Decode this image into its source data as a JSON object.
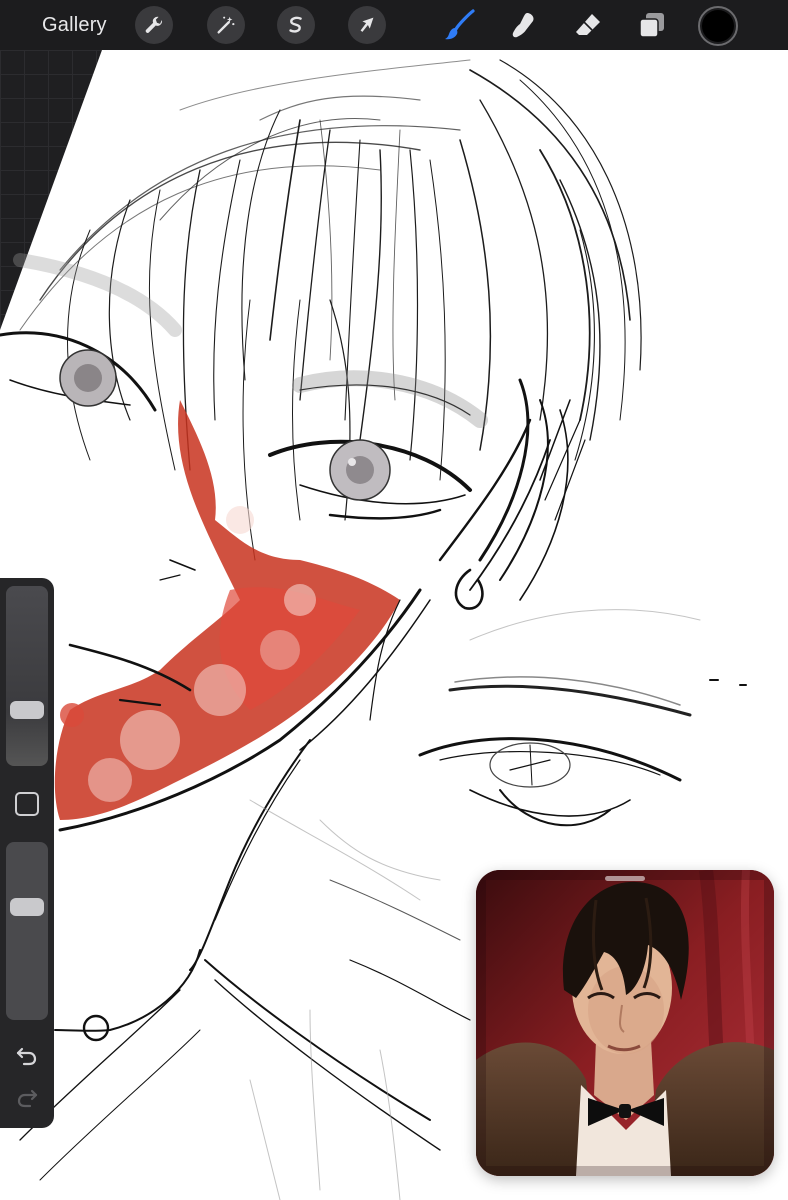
{
  "toolbar": {
    "gallery_label": "Gallery",
    "tools": [
      {
        "id": "actions",
        "icon": "wrench-icon",
        "active": false
      },
      {
        "id": "adjustments",
        "icon": "magic-wand-icon",
        "active": false
      },
      {
        "id": "selection",
        "icon": "selection-s-icon",
        "active": false
      },
      {
        "id": "transform",
        "icon": "arrow-cursor-icon",
        "active": false
      },
      {
        "id": "brush",
        "icon": "brush-icon",
        "active": true
      },
      {
        "id": "smudge",
        "icon": "smudge-finger-icon",
        "active": false
      },
      {
        "id": "eraser",
        "icon": "eraser-icon",
        "active": false
      },
      {
        "id": "layers",
        "icon": "layers-icon",
        "active": false
      }
    ],
    "current_color": "#000000",
    "active_tool_color": "#2f7cf6"
  },
  "sidebar": {
    "brush_size_level": 0.28,
    "brush_opacity_level": 0.66,
    "undo_icon": "undo-arrow-icon",
    "redo_icon": "redo-arrow-icon",
    "modify_icon": "square-modify-icon"
  },
  "canvas": {
    "paper_color": "#ffffff",
    "ink_color": "#1a1a1a",
    "accent_color": "#c8321e"
  },
  "reference": {
    "background_color": "#6e1a1c",
    "icon": "reference-photo"
  }
}
